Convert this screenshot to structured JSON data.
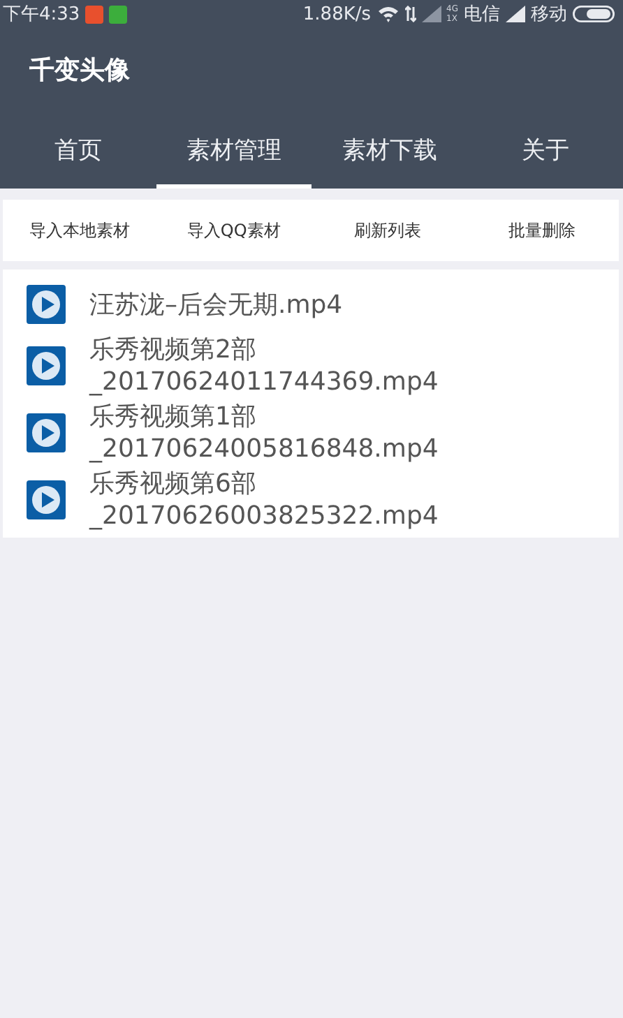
{
  "status_bar": {
    "time": "下午4:33",
    "speed": "1.88K/s",
    "network_tag_top": "4G",
    "network_tag_bottom": "1X",
    "carrier_1": "电信",
    "carrier_2": "移动"
  },
  "app_bar": {
    "title": "千变头像"
  },
  "tabs": [
    {
      "label": "首页",
      "selected": false
    },
    {
      "label": "素材管理",
      "selected": true
    },
    {
      "label": "素材下载",
      "selected": false
    },
    {
      "label": "关于",
      "selected": false
    }
  ],
  "actions": [
    "导入本地素材",
    "导入QQ素材",
    "刷新列表",
    "批量删除"
  ],
  "files": [
    {
      "name": "汪苏泷–后会无期.mp4"
    },
    {
      "name": "乐秀视频第2部_20170624011744369.mp4"
    },
    {
      "name": "乐秀视频第1部_20170624005816848.mp4"
    },
    {
      "name": "乐秀视频第6部_20170626003825322.mp4"
    }
  ]
}
